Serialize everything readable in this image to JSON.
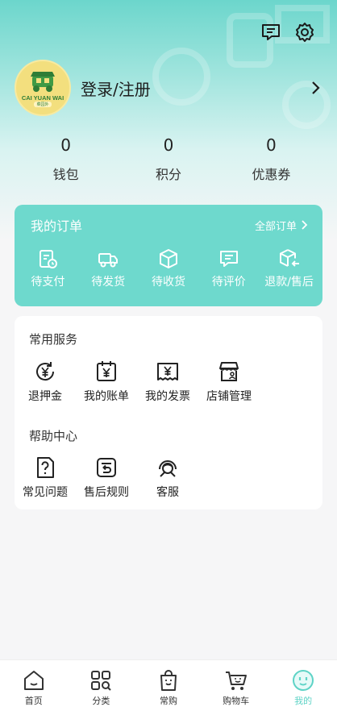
{
  "profile": {
    "login_label": "登录/注册",
    "avatar_brand": "CAI YUAN WAI",
    "avatar_sub": "菜园外"
  },
  "stats": [
    {
      "value": "0",
      "label": "钱包"
    },
    {
      "value": "0",
      "label": "积分"
    },
    {
      "value": "0",
      "label": "优惠券"
    }
  ],
  "orders": {
    "title": "我的订单",
    "all_label": "全部订单",
    "items": [
      {
        "label": "待支付",
        "icon": "clipboard-clock-icon"
      },
      {
        "label": "待发货",
        "icon": "truck-icon"
      },
      {
        "label": "待收货",
        "icon": "box-icon"
      },
      {
        "label": "待评价",
        "icon": "comment-icon"
      },
      {
        "label": "退款/售后",
        "icon": "box-return-icon"
      }
    ]
  },
  "services": {
    "title": "常用服务",
    "items": [
      {
        "label": "退押金",
        "icon": "refund-icon"
      },
      {
        "label": "我的账单",
        "icon": "bill-icon"
      },
      {
        "label": "我的发票",
        "icon": "invoice-icon"
      },
      {
        "label": "店铺管理",
        "icon": "store-icon"
      }
    ]
  },
  "help": {
    "title": "帮助中心",
    "items": [
      {
        "label": "常见问题",
        "icon": "question-icon"
      },
      {
        "label": "售后规则",
        "icon": "return-rule-icon"
      },
      {
        "label": "客服",
        "icon": "customer-service-icon"
      }
    ]
  },
  "tabbar": {
    "items": [
      {
        "label": "首页",
        "icon": "home-icon"
      },
      {
        "label": "分类",
        "icon": "category-icon"
      },
      {
        "label": "常购",
        "icon": "shopping-bag-icon"
      },
      {
        "label": "购物车",
        "icon": "cart-icon"
      },
      {
        "label": "我的",
        "icon": "smiley-icon"
      }
    ],
    "active_index": 4
  },
  "colors": {
    "accent": "#6ed9cd",
    "active_tab": "#5ed3c6"
  }
}
